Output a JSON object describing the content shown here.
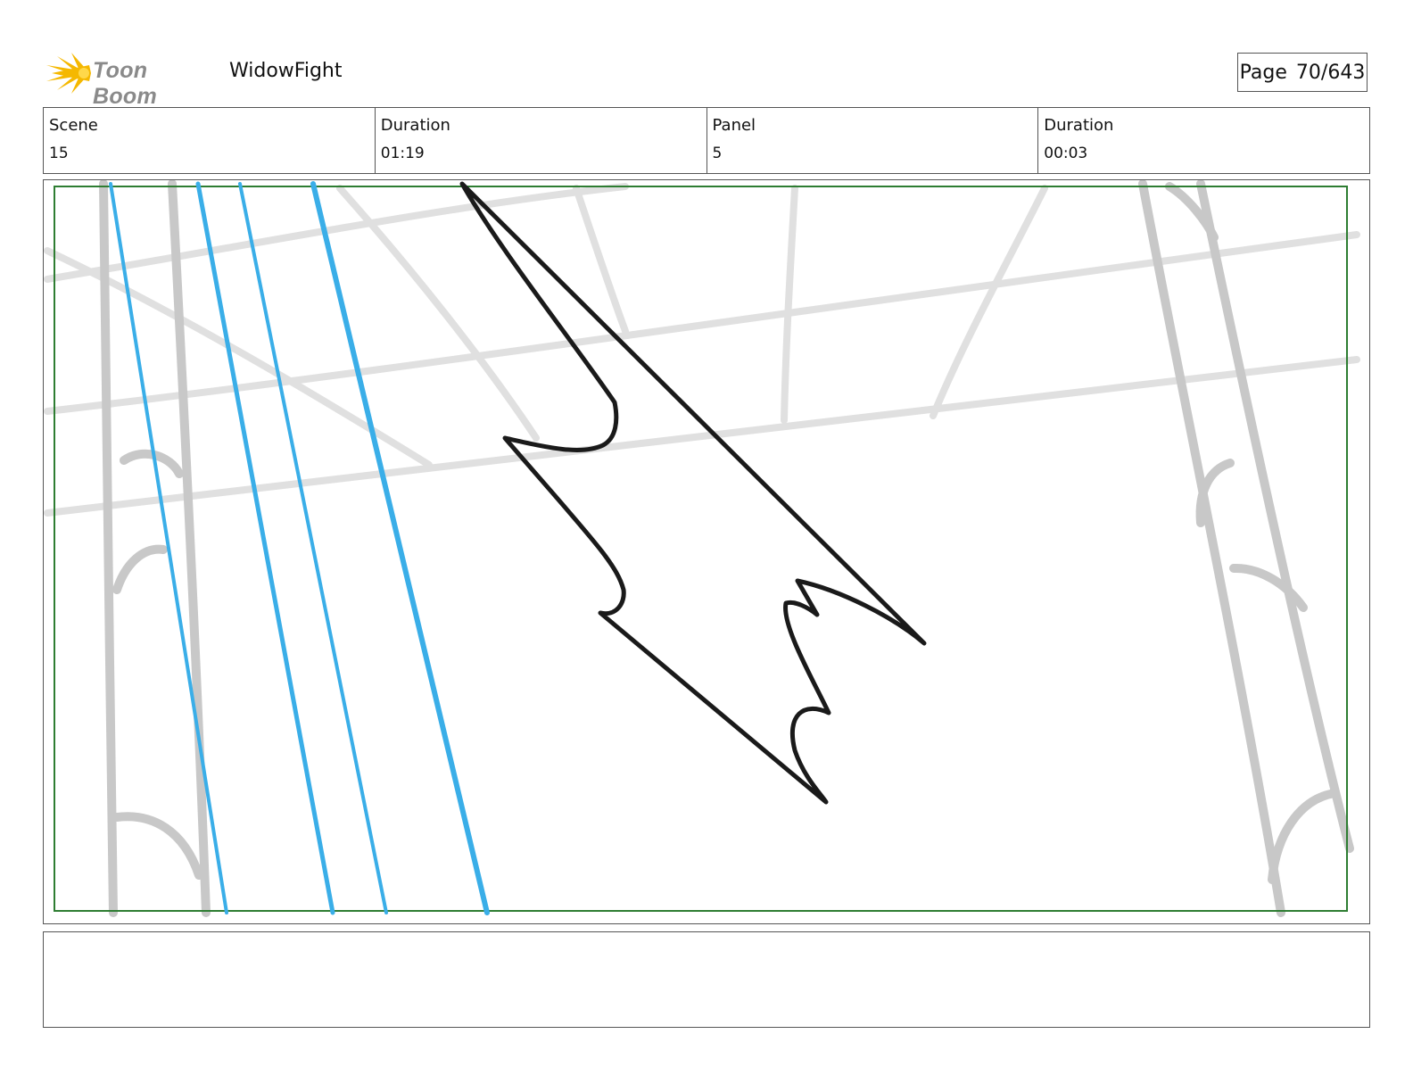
{
  "header": {
    "logo_text": "Toon Boom",
    "project_title": "WidowFight",
    "page_label": "Page",
    "page_number": "70/643"
  },
  "info": {
    "scene_label": "Scene",
    "scene_value": "15",
    "scene_duration_label": "Duration",
    "scene_duration_value": "01:19",
    "panel_label": "Panel",
    "panel_value": "5",
    "panel_duration_label": "Duration",
    "panel_duration_value": "00:03"
  },
  "colors": {
    "safe_area_border": "#2e7d32",
    "blue_speed_lines": "#3aaee8",
    "background_sketch": "#c8c8c8",
    "ink": "#1a1a1a",
    "logo_star": "#f5b800"
  },
  "notes": {
    "text": ""
  }
}
